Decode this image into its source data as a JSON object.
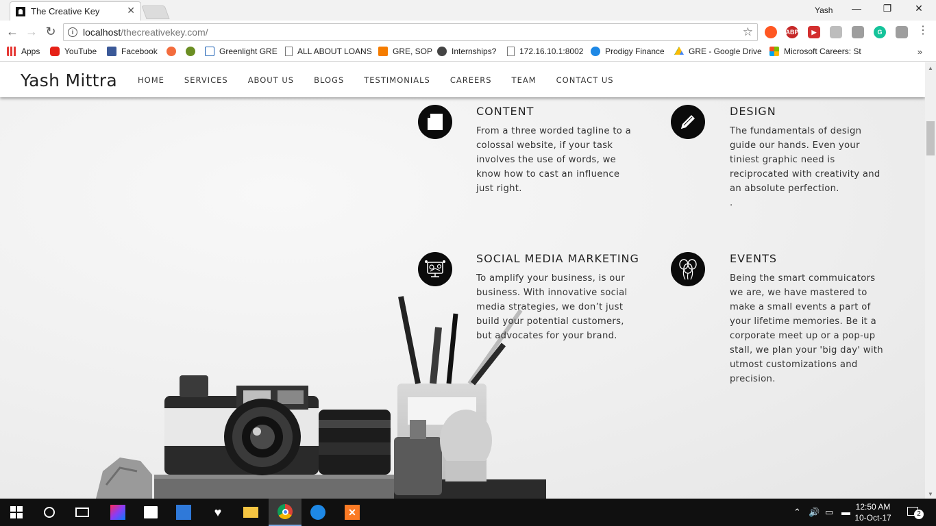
{
  "browser": {
    "tab_title": "The Creative Key",
    "user": "Yash",
    "url_host": "localhost",
    "url_path": "/thecreativekey.com/",
    "bookmarks": [
      {
        "label": "Apps",
        "color": "#e53935"
      },
      {
        "label": "YouTube",
        "color": "#e62117"
      },
      {
        "label": "Facebook",
        "color": "#3b5998"
      },
      {
        "label": "",
        "color": "#f36c3d"
      },
      {
        "label": "",
        "color": "#6b8e23"
      },
      {
        "label": "Greenlight GRE",
        "color": "#1a5fb4"
      },
      {
        "label": "ALL ABOUT LOANS",
        "color": "#888888"
      },
      {
        "label": "GRE, SOP",
        "color": "#f57c00"
      },
      {
        "label": "Internships?",
        "color": "#444444"
      },
      {
        "label": "172.16.10.1:8002",
        "color": "#888888"
      },
      {
        "label": "Prodigy Finance",
        "color": "#1e88e5"
      },
      {
        "label": "GRE - Google Drive",
        "color": "#fbbc05"
      },
      {
        "label": "Microsoft Careers: St",
        "color": "#f25022"
      }
    ]
  },
  "site": {
    "brand": "Yash Mittra",
    "menu": [
      "HOME",
      "SERVICES",
      "ABOUT US",
      "BLOGS",
      "TESTIMONIALS",
      "CAREERS",
      "TEAM",
      "CONTACT US"
    ],
    "services": [
      {
        "title": "CONTENT",
        "icon": "document-icon",
        "text": "From a three worded tagline to a colossal website, if your task involves the use of words, we know how to cast an influence just right."
      },
      {
        "title": "DESIGN",
        "icon": "pencil-icon",
        "text": "The fundamentals of design guide our hands. Even your tiniest graphic need is reciprocated with creativity and an absolute perfection.\n."
      },
      {
        "title": "SOCIAL MEDIA MARKETING",
        "icon": "social-media-icon",
        "text": "To amplify your business, is our business. With innovative social media strategies, we don’t just build your potential customers, but advocates for your brand."
      },
      {
        "title": "EVENTS",
        "icon": "balloons-icon",
        "text": "Being the smart commuicators we are, we have mastered to make a small events a part of your lifetime memories. Be it a corporate meet up or a pop-up stall, we plan your 'big day' with utmost customizations and precision."
      }
    ]
  },
  "taskbar": {
    "time": "12:50 AM",
    "date": "10-Oct-17",
    "notifications": "2"
  }
}
